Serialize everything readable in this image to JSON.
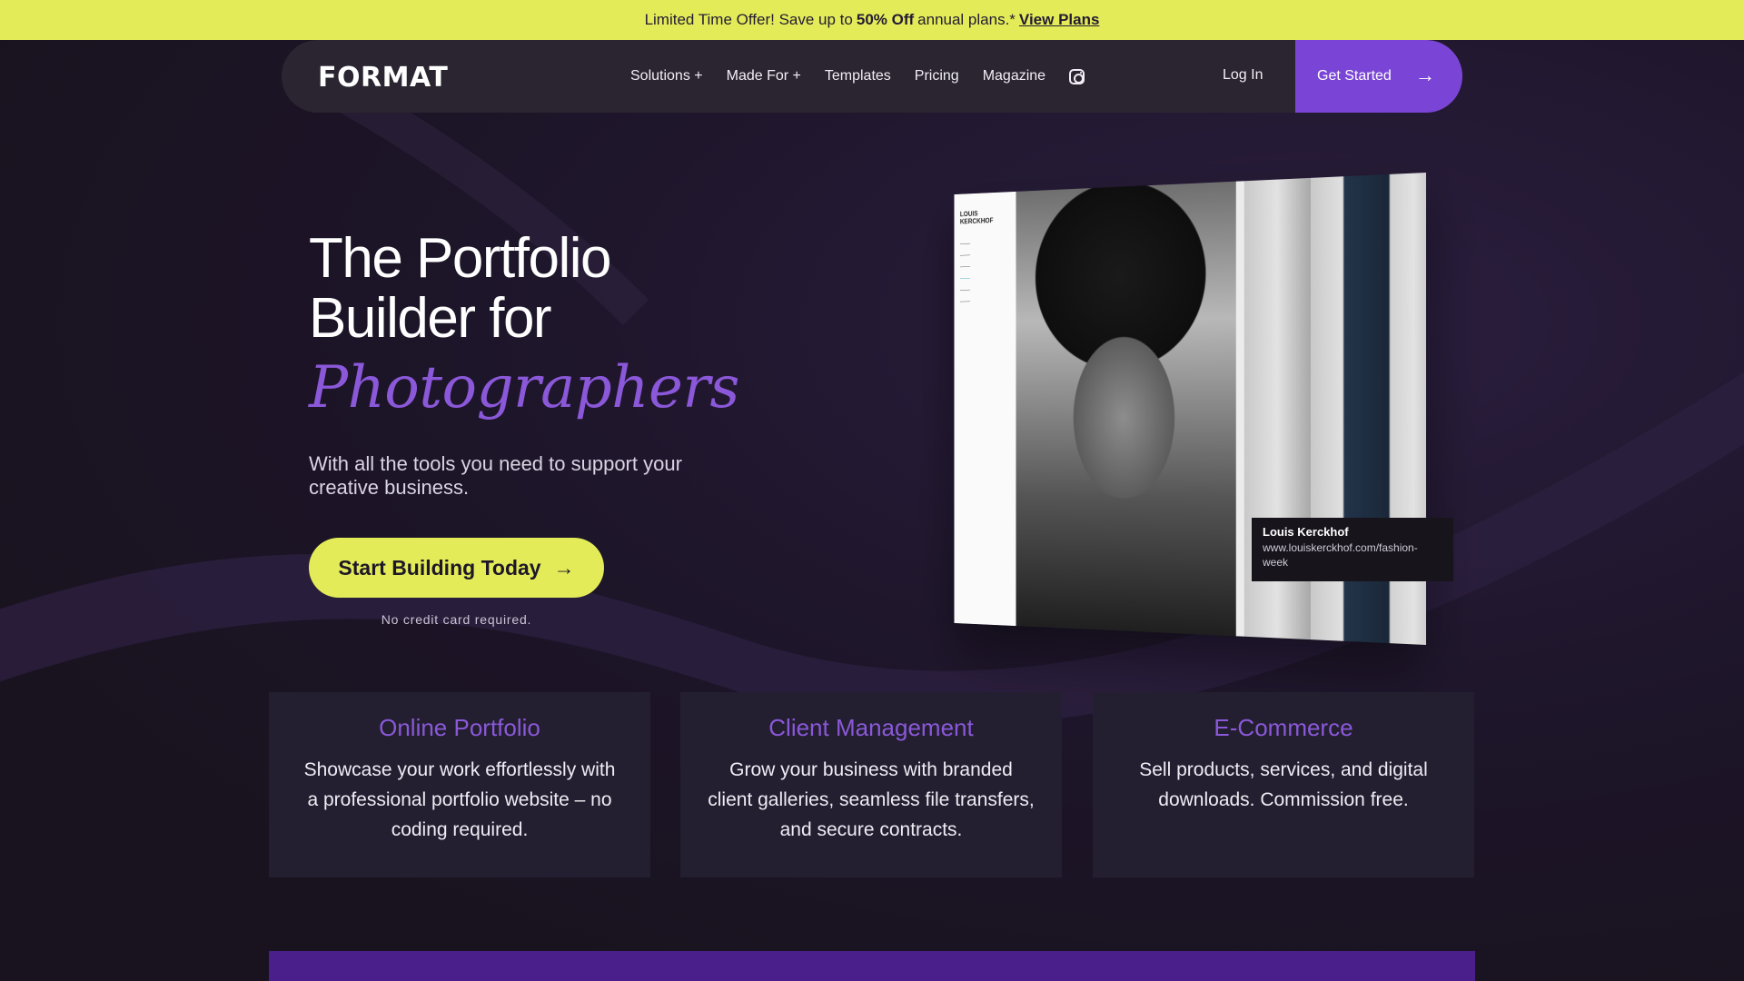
{
  "promo": {
    "text": "Limited Time Offer! Save up to",
    "highlight": "50% Off",
    "suffix": "annual plans.*",
    "link": "View Plans"
  },
  "nav": {
    "logo": "FORMAT",
    "links": [
      "Solutions +",
      "Made For +",
      "Templates",
      "Pricing",
      "Magazine"
    ],
    "login": "Log In",
    "cta": "Get Started"
  },
  "hero": {
    "title_line1": "The Portfolio",
    "title_line2": "Builder for",
    "title_italic": "Photographers",
    "subtitle": "With all the tools you need to support your creative business.",
    "cta": "Start Building Today",
    "cta_note": "No credit card required."
  },
  "mockup": {
    "brand_line1": "LOUIS",
    "brand_line2": "KERCKHOF",
    "caption_name": "Louis Kerckhof",
    "caption_url": "www.louiskerckhof.com/fashion-week"
  },
  "features": [
    {
      "title": "Online Portfolio",
      "text": "Showcase your work effortlessly with a professional portfolio website – no coding  required."
    },
    {
      "title": "Client Management",
      "text": "Grow your business with branded client galleries, seamless file transfers, and secure contracts."
    },
    {
      "title": "E-Commerce",
      "text": "Sell products, services, and digital downloads. Commission free."
    }
  ],
  "colors": {
    "accent_yellow": "#e3ec58",
    "accent_purple": "#7a45d6",
    "background": "#1a1424"
  }
}
